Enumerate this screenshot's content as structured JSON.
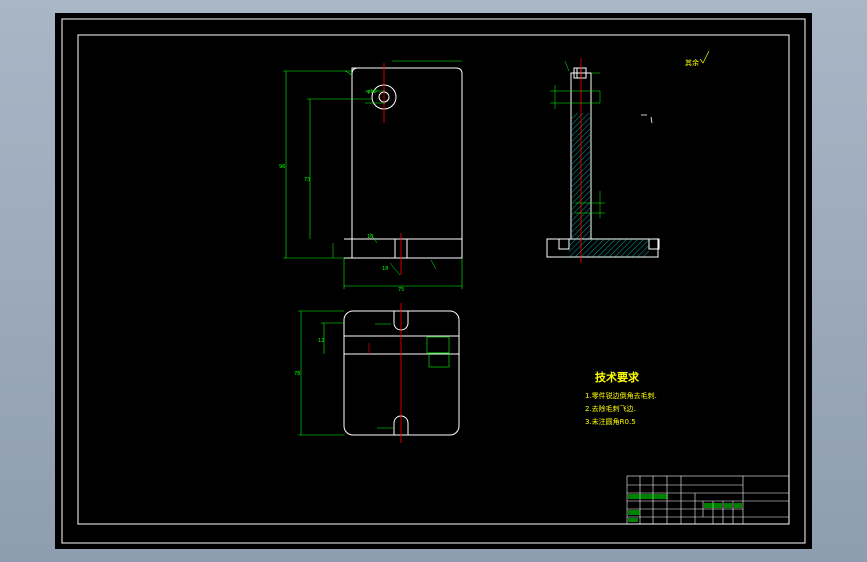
{
  "colors": {
    "background": "#000000",
    "border": "#ffffff",
    "dimension": "#00ff00",
    "centerline": "#ff0000",
    "annotation": "#ffff00",
    "hatch": "#00ffff"
  },
  "drawing": {
    "tech_requirements": {
      "title": "技术要求",
      "items": [
        "1.零件锐边倒角去毛刺.",
        "2.去除毛刺飞边.",
        "3.未注圆角R0.5"
      ]
    },
    "roughness_note": "其余",
    "dims": {
      "height_outer": "96",
      "height_inner": "73",
      "width_bottom": "75",
      "plan_height": "78",
      "plan_small": "12",
      "small_dim_1": "18",
      "small_dim_2": "10",
      "hole_dim": "φ10"
    }
  }
}
